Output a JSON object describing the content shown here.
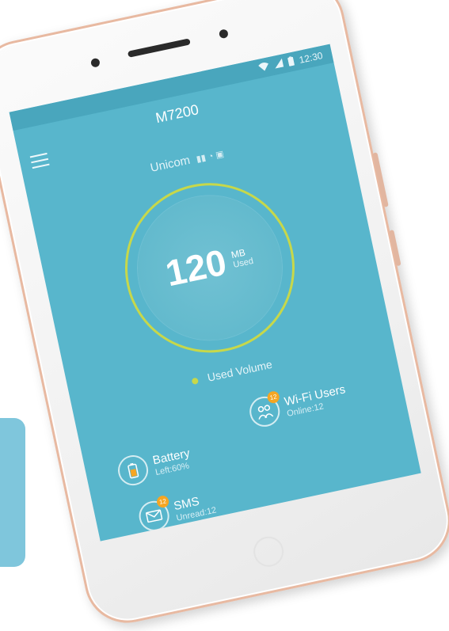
{
  "status_bar": {
    "time": "12:30"
  },
  "header": {
    "title": "M7200"
  },
  "carrier": {
    "name": "Unicom"
  },
  "usage": {
    "value": "120",
    "unit": "MB",
    "label": "Used"
  },
  "legend": {
    "label": "Used Volume"
  },
  "tiles": {
    "wifi": {
      "title": "Wi-Fi Users",
      "subtitle": "Online:12",
      "badge": "12"
    },
    "battery": {
      "title": "Battery",
      "subtitle": "Left:60%",
      "level": 0.6
    },
    "sms": {
      "title": "SMS",
      "subtitle": "Unread:12",
      "badge": "12"
    }
  },
  "colors": {
    "screen": "#58b6cc",
    "status_bar": "#49a6bd",
    "gauge_ring": "#c7d84a",
    "badge": "#f5a623",
    "phone_frame": "#e8b9a1",
    "side_card": "#7fc6dc"
  },
  "icons": [
    "menu-icon",
    "wifi-icon",
    "signal-icon",
    "battery-icon",
    "users-icon",
    "envelope-icon"
  ]
}
